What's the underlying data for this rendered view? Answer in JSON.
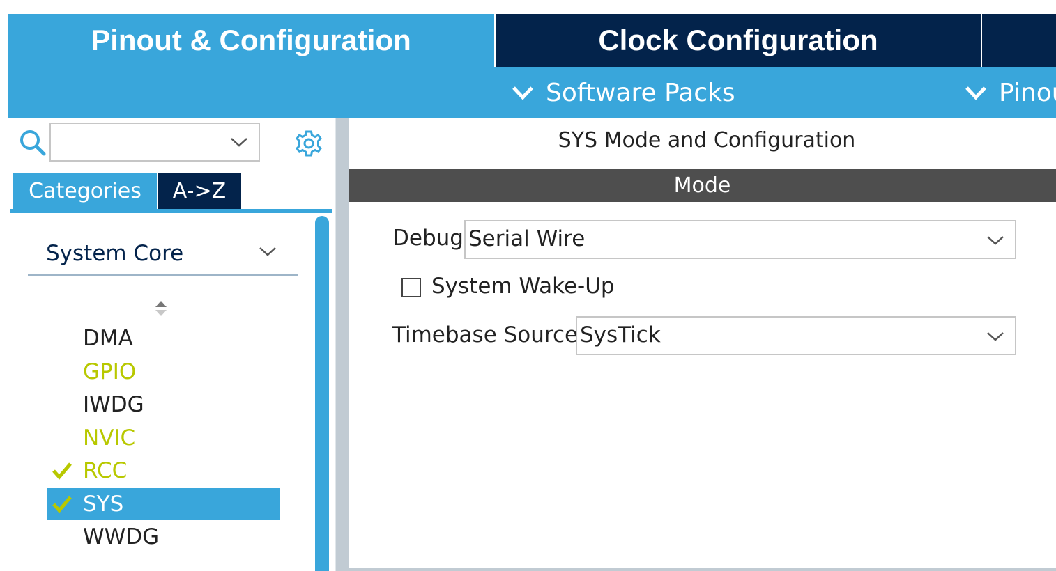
{
  "tabs": {
    "pinout": "Pinout & Configuration",
    "clock": "Clock Configuration"
  },
  "submenu": {
    "software_packs": "Software Packs",
    "pinout": "Pinout"
  },
  "left_panel": {
    "search": {
      "value": ""
    },
    "category_tabs": [
      "Categories",
      "A->Z"
    ],
    "group": "System Core",
    "items": [
      {
        "label": "DMA",
        "color": "#222222",
        "checked": false,
        "selected": false
      },
      {
        "label": "GPIO",
        "color": "#b8c800",
        "checked": false,
        "selected": false
      },
      {
        "label": "IWDG",
        "color": "#222222",
        "checked": false,
        "selected": false
      },
      {
        "label": "NVIC",
        "color": "#b8c800",
        "checked": false,
        "selected": false
      },
      {
        "label": "RCC",
        "color": "#b8c800",
        "checked": true,
        "selected": false
      },
      {
        "label": "SYS",
        "color": "#ffffff",
        "checked": true,
        "selected": true
      },
      {
        "label": "WWDG",
        "color": "#222222",
        "checked": false,
        "selected": false
      }
    ]
  },
  "right_panel": {
    "title": "SYS Mode and Configuration",
    "mode_header": "Mode",
    "debug": {
      "label": "Debug",
      "value": "Serial Wire"
    },
    "wake_up": {
      "label": "System Wake-Up",
      "checked": false
    },
    "timebase": {
      "label": "Timebase Source",
      "value": "SysTick"
    }
  },
  "colors": {
    "accent": "#39a6db",
    "dark_navy": "#03234b",
    "mode_bar": "#4e4e4e",
    "check_green": "#b8c800"
  }
}
